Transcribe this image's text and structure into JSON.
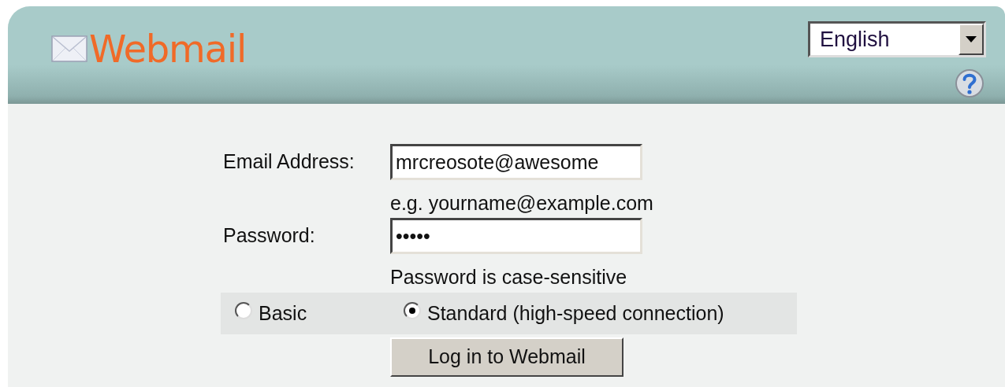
{
  "header": {
    "logo": "Webmail",
    "language": {
      "value": "English"
    }
  },
  "form": {
    "email": {
      "label": "Email Address:",
      "value": "mrcreosote@awesome",
      "hint": "e.g. yourname@example.com"
    },
    "password": {
      "label": "Password:",
      "value": "•••••",
      "hint": "Password is case-sensitive"
    },
    "modes": [
      {
        "label": "Basic",
        "selected": false
      },
      {
        "label": "Standard (high-speed connection)",
        "selected": true
      }
    ],
    "submit": "Log in to Webmail"
  }
}
